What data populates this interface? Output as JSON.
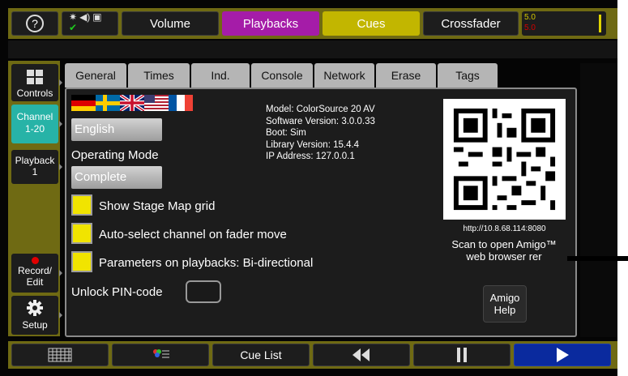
{
  "topbar": {
    "help_label": "?",
    "volume": "Volume",
    "playbacks": "Playbacks",
    "cues": "Cues",
    "crossfader": "Crossfader",
    "fader_value_a": "5.0",
    "fader_value_b": "5.0"
  },
  "sidebar": {
    "controls": "Controls",
    "channel_line1": "Channel",
    "channel_line2": "1-20",
    "playback_line1": "Playback",
    "playback_line2": "1",
    "record_line1": "Record/",
    "record_line2": "Edit",
    "setup": "Setup"
  },
  "tabs": [
    "General",
    "Times",
    "Ind.",
    "Console",
    "Network",
    "Erase",
    "Tags"
  ],
  "general": {
    "language_value": "English",
    "operating_mode_label": "Operating Mode",
    "operating_mode_value": "Complete",
    "checkboxes": [
      {
        "label": "Show Stage Map grid",
        "checked": true
      },
      {
        "label": "Auto-select channel on fader move",
        "checked": true
      },
      {
        "label": "Parameters on playbacks: Bi-directional",
        "checked": true
      }
    ],
    "pin_label": "Unlock PIN-code",
    "pin_value": ""
  },
  "info": {
    "model": "Model: ColorSource 20 AV",
    "software": "Software Version: 3.0.0.33",
    "boot": "Boot: Sim",
    "library": "Library Version: 15.4.4",
    "ip": "IP Address: 127.0.0.1"
  },
  "amigo": {
    "url": "http://10.8.68.114:8080",
    "scan_line1": "Scan to open Amigo™",
    "scan_line2": "web browser rer",
    "help_line1": "Amigo",
    "help_line2": "Help"
  },
  "bottombar": {
    "cue_list": "Cue List"
  },
  "colors": {
    "olive": "#6f6a13",
    "playbacks": "#a51ca8",
    "cues": "#c2b600",
    "channel": "#27b3a7",
    "checkbox": "#f1e400",
    "go_button": "#0a2a9e"
  }
}
